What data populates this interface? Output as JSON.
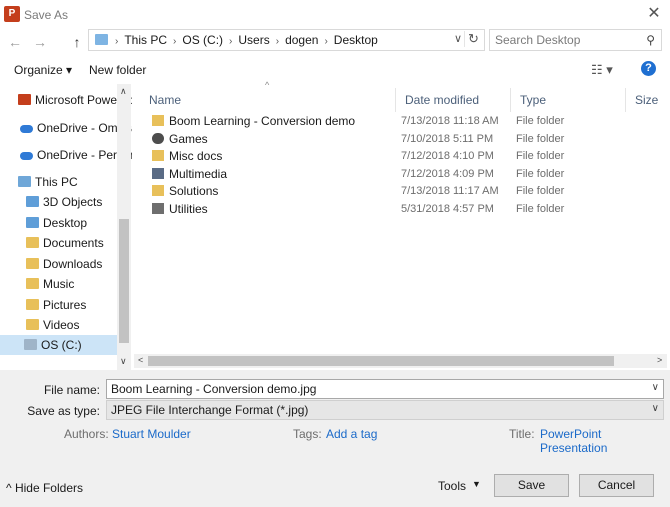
{
  "window": {
    "title": "Save As",
    "app_icon": "powerpoint-icon",
    "close_glyph": "✕"
  },
  "nav": {
    "back": "←",
    "forward": "→",
    "up": "↑"
  },
  "address": {
    "crumbs": [
      "This PC",
      "OS (C:)",
      "Users",
      "dogen",
      "Desktop"
    ],
    "dropdown_glyph": "∨",
    "refresh_glyph": "↻"
  },
  "search": {
    "placeholder": "Search Desktop",
    "icon_glyph": "⚲"
  },
  "toolbar": {
    "organize": "Organize ▾",
    "new_folder": "New folder",
    "view_glyph": "☷ ▾",
    "help_glyph": "?"
  },
  "sidebar": {
    "items": [
      {
        "label": "Microsoft PowerPoint",
        "icon": "powerpoint-icon"
      },
      {
        "label": "OneDrive - Omega",
        "icon": "onedrive-icon"
      },
      {
        "label": "OneDrive - Personal",
        "icon": "onedrive-icon"
      },
      {
        "label": "This PC",
        "icon": "computer-icon"
      },
      {
        "label": "3D Objects",
        "icon": "folder-icon"
      },
      {
        "label": "Desktop",
        "icon": "folder-icon"
      },
      {
        "label": "Documents",
        "icon": "folder-icon"
      },
      {
        "label": "Downloads",
        "icon": "folder-icon"
      },
      {
        "label": "Music",
        "icon": "folder-icon"
      },
      {
        "label": "Pictures",
        "icon": "folder-icon"
      },
      {
        "label": "Videos",
        "icon": "folder-icon"
      },
      {
        "label": "OS (C:)",
        "icon": "drive-icon"
      }
    ],
    "selected": "OS (C:)",
    "scroll_up": "∧",
    "scroll_down": "∨"
  },
  "filelist": {
    "columns": {
      "name": "Name",
      "date": "Date modified",
      "type": "Type",
      "size": "Size"
    },
    "sort_glyph": "^",
    "rows": [
      {
        "name": "Boom Learning - Conversion demo",
        "date": "7/13/2018 11:18 AM",
        "type": "File folder",
        "icon": "folder-icon"
      },
      {
        "name": "Games",
        "date": "7/10/2018 5:11 PM",
        "type": "File folder",
        "icon": "games-icon"
      },
      {
        "name": "Misc docs",
        "date": "7/12/2018 4:10 PM",
        "type": "File folder",
        "icon": "folder-icon"
      },
      {
        "name": "Multimedia",
        "date": "7/12/2018 4:09 PM",
        "type": "File folder",
        "icon": "multimedia-icon"
      },
      {
        "name": "Solutions",
        "date": "7/13/2018 11:17 AM",
        "type": "File folder",
        "icon": "folder-icon"
      },
      {
        "name": "Utilities",
        "date": "5/31/2018 4:57 PM",
        "type": "File folder",
        "icon": "tools-icon"
      }
    ],
    "scroll_left": "<",
    "scroll_right": ">"
  },
  "form": {
    "file_name_label": "File name:",
    "file_name_value": "Boom Learning - Conversion demo.jpg",
    "save_type_label": "Save as type:",
    "save_type_value": "JPEG File Interchange Format (*.jpg)",
    "dropdown_glyph": "∨"
  },
  "meta": {
    "authors_label": "Authors:",
    "authors_value": "Stuart Moulder",
    "tags_label": "Tags:",
    "tags_value": "Add a tag",
    "title_label": "Title:",
    "title_value": "PowerPoint Presentation"
  },
  "footer": {
    "hide_folders": "^  Hide Folders",
    "tools": "Tools",
    "tools_caret": "▼",
    "save": "Save",
    "cancel": "Cancel"
  }
}
